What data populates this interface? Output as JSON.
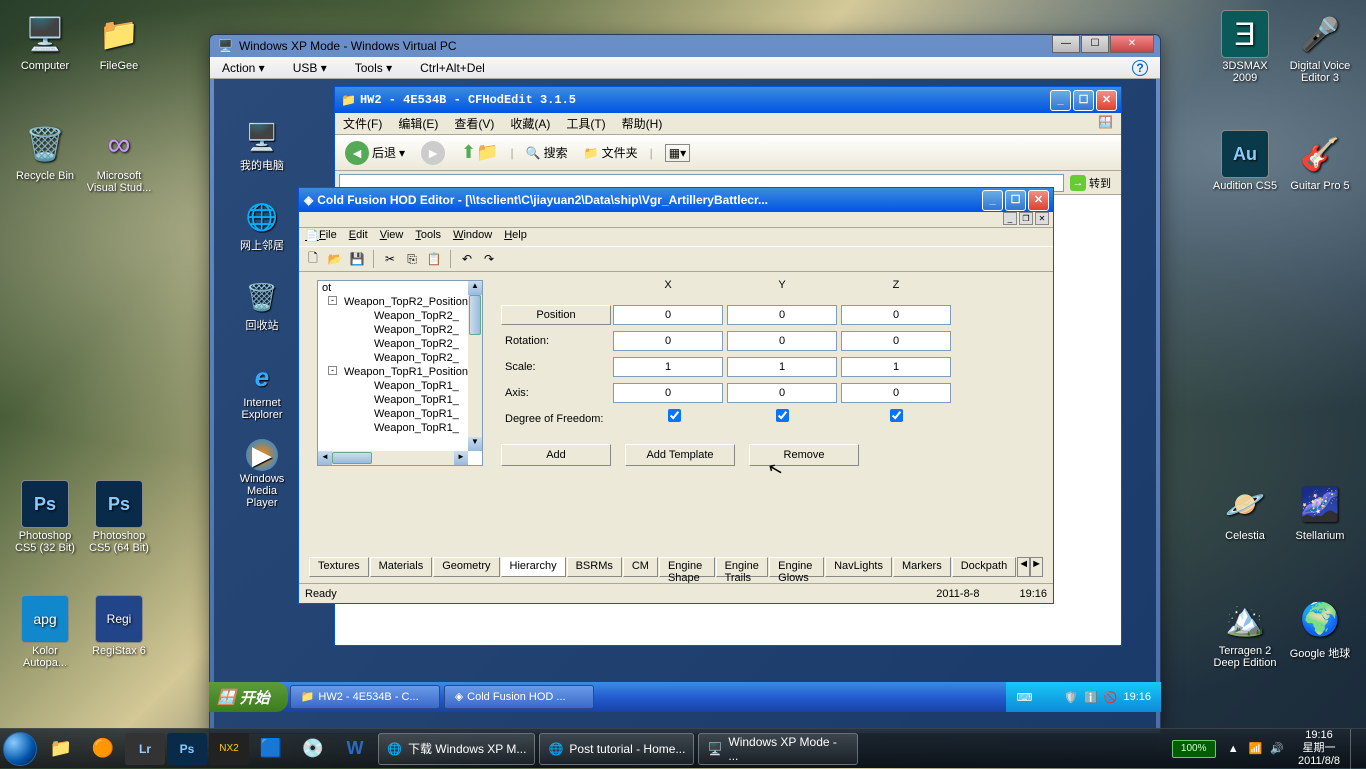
{
  "desktop": {
    "left_icons": [
      {
        "label": "Computer",
        "glyph": "🖥️"
      },
      {
        "label": "FileGee",
        "glyph": "📁"
      },
      {
        "label": "Recycle Bin",
        "glyph": "🗑️"
      },
      {
        "label": "Microsoft Visual Stud...",
        "glyph": "∞"
      },
      {
        "label": "Photoshop CS5 (32 Bit)",
        "glyph": "Ps"
      },
      {
        "label": "Photoshop CS5 (64 Bit)",
        "glyph": "Ps"
      },
      {
        "label": "Kolor Autopa...",
        "glyph": "apg"
      },
      {
        "label": "RegiStax 6",
        "glyph": "Regi"
      }
    ],
    "right_icons": [
      {
        "label": "3DSMAX 2009",
        "glyph": "Ǝ"
      },
      {
        "label": "Digital Voice Editor 3",
        "glyph": "🎤"
      },
      {
        "label": "Audition CS5",
        "glyph": "Au"
      },
      {
        "label": "Guitar Pro 5",
        "glyph": "🎸"
      },
      {
        "label": "Celestia",
        "glyph": "🪐"
      },
      {
        "label": "Stellarium",
        "glyph": "🌌"
      },
      {
        "label": "Terragen 2 Deep Edition",
        "glyph": "🏔️"
      },
      {
        "label": "Google 地球",
        "glyph": "🌍"
      }
    ]
  },
  "vm": {
    "title": "Windows XP Mode - Windows Virtual PC",
    "menu": [
      "Action ▾",
      "USB ▾",
      "Tools ▾",
      "Ctrl+Alt+Del"
    ],
    "xp_icons": [
      {
        "label": "我的电脑",
        "glyph": "🖥️"
      },
      {
        "label": "网上邻居",
        "glyph": "🌐"
      },
      {
        "label": "回收站",
        "glyph": "🗑️"
      },
      {
        "label": "Internet Explorer",
        "glyph": "e"
      },
      {
        "label": "Windows Media Player",
        "glyph": "▶"
      }
    ]
  },
  "explorer": {
    "title": "HW2 - 4E534B - CFHodEdit 3.1.5",
    "menus": [
      "文件(F)",
      "编辑(E)",
      "查看(V)",
      "收藏(A)",
      "工具(T)",
      "帮助(H)"
    ],
    "back": "后退",
    "search": "搜索",
    "folders": "文件夹",
    "goto": "转到"
  },
  "hod": {
    "title": "Cold Fusion HOD Editor - [\\\\tsclient\\C\\jiayuan2\\Data\\ship\\Vgr_ArtilleryBattlecr...",
    "menus": [
      "File",
      "Edit",
      "View",
      "Tools",
      "Window",
      "Help"
    ],
    "tree": [
      {
        "lvl": 0,
        "text": "ot"
      },
      {
        "lvl": 1,
        "text": "Weapon_TopR2_Position",
        "exp": "-"
      },
      {
        "lvl": 2,
        "text": "Weapon_TopR2_"
      },
      {
        "lvl": 2,
        "text": "Weapon_TopR2_"
      },
      {
        "lvl": 2,
        "text": "Weapon_TopR2_"
      },
      {
        "lvl": 2,
        "text": "Weapon_TopR2_"
      },
      {
        "lvl": 1,
        "text": "Weapon_TopR1_Position",
        "exp": "-"
      },
      {
        "lvl": 2,
        "text": "Weapon_TopR1_"
      },
      {
        "lvl": 2,
        "text": "Weapon_TopR1_"
      },
      {
        "lvl": 2,
        "text": "Weapon_TopR1_"
      },
      {
        "lvl": 2,
        "text": "Weapon_TopR1_"
      }
    ],
    "headers": {
      "x": "X",
      "y": "Y",
      "z": "Z"
    },
    "rows": {
      "position": {
        "label": "Position",
        "x": "0",
        "y": "0",
        "z": "0",
        "is_button": true
      },
      "rotation": {
        "label": "Rotation:",
        "x": "0",
        "y": "0",
        "z": "0"
      },
      "scale": {
        "label": "Scale:",
        "x": "1",
        "y": "1",
        "z": "1"
      },
      "axis": {
        "label": "Axis:",
        "x": "0",
        "y": "0",
        "z": "0"
      },
      "dof": {
        "label": "Degree of Freedom:",
        "x": true,
        "y": true,
        "z": true
      }
    },
    "actions": {
      "add": "Add",
      "add_template": "Add Template",
      "remove": "Remove"
    },
    "tabs": [
      "Textures",
      "Materials",
      "Geometry",
      "Hierarchy",
      "BSRMs",
      "CM",
      "Engine Shape",
      "Engine Trails",
      "Engine Glows",
      "NavLights",
      "Markers",
      "Dockpath"
    ],
    "active_tab": 3,
    "status": {
      "ready": "Ready",
      "date": "2011-8-8",
      "time": "19:16"
    }
  },
  "xp_taskbar": {
    "start": "开始",
    "tasks": [
      "HW2 - 4E534B - C...",
      "Cold Fusion HOD ..."
    ],
    "time": "19:16"
  },
  "win7_taskbar": {
    "tasks": [
      "下载 Windows XP M...",
      "Post tutorial - Home...",
      "Windows XP Mode - ..."
    ],
    "battery": "100%",
    "time": "19:16",
    "day": "星期一",
    "date": "2011/8/8"
  }
}
